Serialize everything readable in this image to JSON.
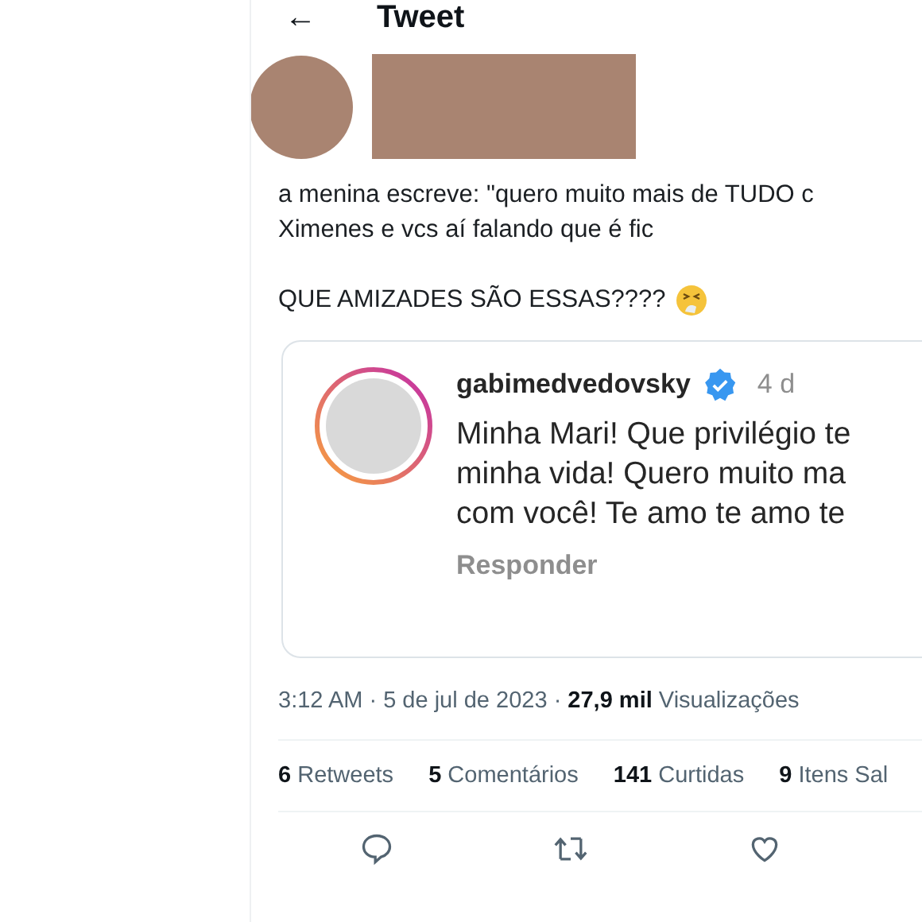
{
  "header": {
    "back": "←",
    "title": "Tweet"
  },
  "tweet": {
    "text_lines": [
      "a menina escreve: \"quero muito mais de TUDO c",
      "Ximenes e vcs aí falando que é fic"
    ],
    "exclaim": "QUE AMIZADES SÃO ESSAS????"
  },
  "embedded_comment": {
    "username": "gabimedvedovsky",
    "verified": true,
    "age": "4 d",
    "lines": [
      "Minha Mari! Que privilégio te",
      "minha vida! Quero muito ma",
      "com você! Te amo te amo te"
    ],
    "reply": "Responder"
  },
  "meta": "3:12 AM · 5 de jul de 2023 · **27,9 mil** Visualizações",
  "stats": [
    "**6** Retweets",
    "**5** Comentários",
    "**141** Curtidas",
    "**9** Itens Sal"
  ],
  "actions": [
    {
      "kind": "reply"
    },
    {
      "kind": "retweet"
    },
    {
      "kind": "like"
    }
  ]
}
